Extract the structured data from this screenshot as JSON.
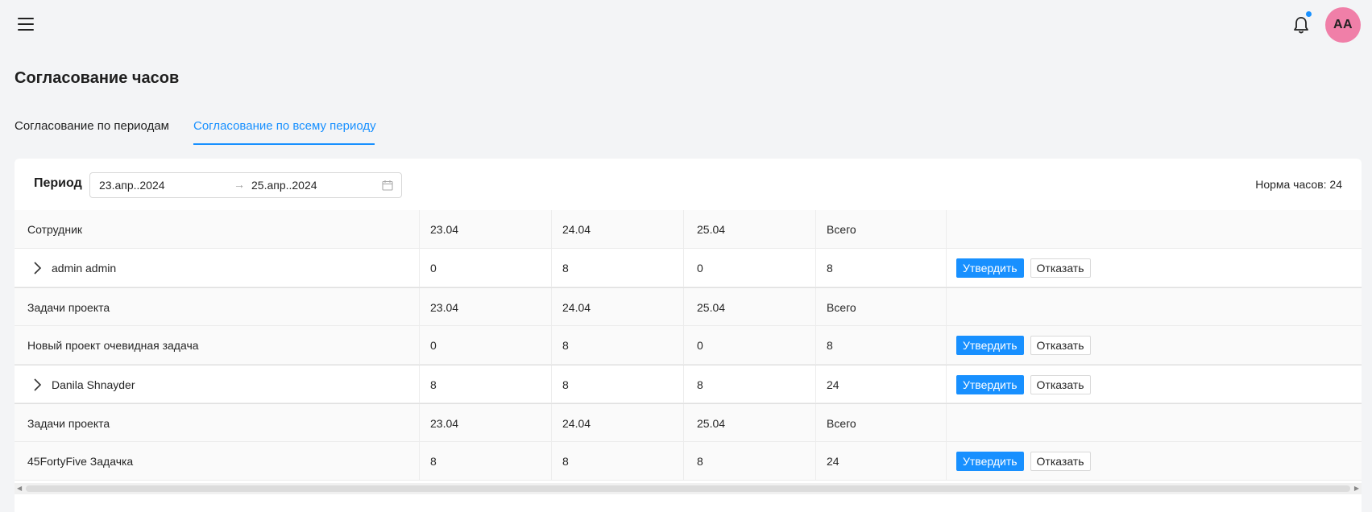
{
  "header": {
    "avatar_initials": "AA"
  },
  "page": {
    "title": "Согласование часов"
  },
  "tabs": [
    {
      "label": "Согласование по периодам",
      "active": false
    },
    {
      "label": "Согласование по всему периоду",
      "active": true
    }
  ],
  "filter": {
    "period_label": "Период",
    "start_date": "23.апр..2024",
    "end_date": "25.апр..2024",
    "arrow": "→",
    "norma": "Норма часов: 24"
  },
  "table": {
    "header": {
      "name": "Сотрудник",
      "d1": "23.04",
      "d2": "24.04",
      "d3": "25.04",
      "total": "Всего"
    },
    "employees": [
      {
        "name": "admin admin",
        "d1": "0",
        "d2": "8",
        "d3": "0",
        "total": "8",
        "tasks_header": {
          "name": "Задачи проекта",
          "d1": "23.04",
          "d2": "24.04",
          "d3": "25.04",
          "total": "Всего"
        },
        "tasks": [
          {
            "name": "Новый проект очевидная задача",
            "d1": "0",
            "d2": "8",
            "d3": "0",
            "total": "8"
          }
        ]
      },
      {
        "name": "Danila Shnayder",
        "d1": "8",
        "d2": "8",
        "d3": "8",
        "total": "24",
        "tasks_header": {
          "name": "Задачи проекта",
          "d1": "23.04",
          "d2": "24.04",
          "d3": "25.04",
          "total": "Всего"
        },
        "tasks": [
          {
            "name": "45FortyFive Задачка",
            "d1": "8",
            "d2": "8",
            "d3": "8",
            "total": "24"
          }
        ]
      }
    ],
    "approve_label": "Утвердить",
    "reject_label": "Отказать"
  },
  "colors": {
    "accent": "#1890ff",
    "avatar_bg": "#f07fa8",
    "page_bg": "#f3f4f6"
  },
  "icons": [
    "menu-icon",
    "bell-icon",
    "calendar-icon",
    "chevron-right-icon"
  ]
}
